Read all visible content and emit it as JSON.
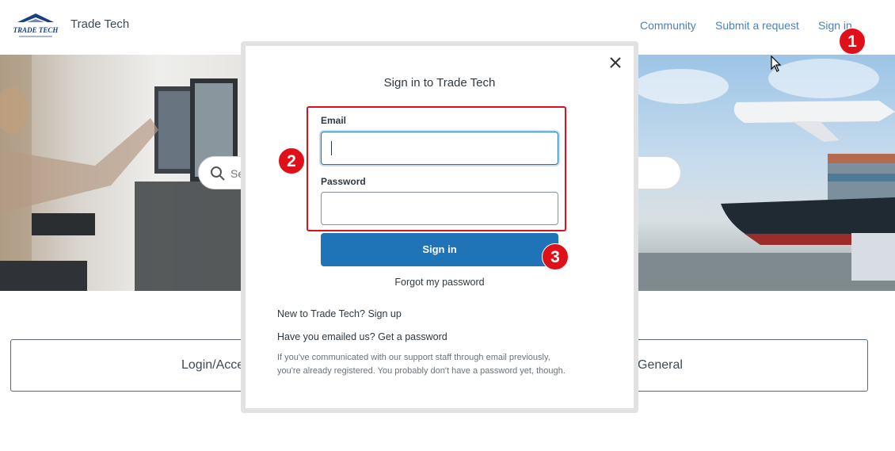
{
  "header": {
    "brand_name": "Trade Tech",
    "logo_text": "TRADE TECH",
    "nav": {
      "community": "Community",
      "submit_request": "Submit a request",
      "sign_in": "Sign in"
    }
  },
  "hero": {
    "search_placeholder": "Sea"
  },
  "categories": {
    "login_access": "Login/Acces",
    "general": "General"
  },
  "modal": {
    "title": "Sign in to Trade Tech",
    "email_label": "Email",
    "password_label": "Password",
    "email_value": "",
    "password_value": "",
    "sign_in_button": "Sign in",
    "forgot_password": "Forgot my password",
    "new_to_prefix": "New to Trade Tech?",
    "sign_up_link": "Sign up",
    "emailed_prefix": "Have you emailed us?",
    "get_password_link": "Get a password",
    "help_line1": "If you've communicated with our support staff through email previously,",
    "help_line2": "you're already registered. You probably don't have a password yet, though."
  },
  "annotations": {
    "step1": "1",
    "step2": "2",
    "step3": "3"
  },
  "colors": {
    "link": "#4d7fb8",
    "primary_button": "#1f73b7",
    "annotation_red": "#e0101a"
  },
  "icons": [
    "search-icon",
    "close-icon",
    "mouse-cursor-icon"
  ]
}
